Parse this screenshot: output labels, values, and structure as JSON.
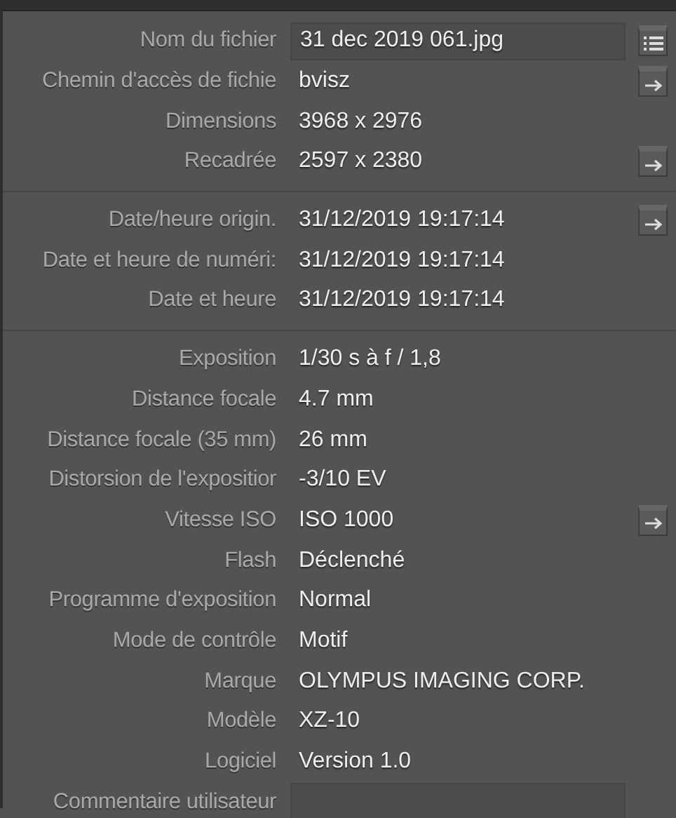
{
  "sections": [
    {
      "rows": [
        {
          "label": "Nom du fichier",
          "value": "31 dec 2019 061.jpg",
          "kind": "field",
          "button": {
            "kind": "list"
          }
        },
        {
          "label": "Chemin d'accès de fichie",
          "value": "bvisz",
          "kind": "plain",
          "button": {
            "kind": "arrow"
          }
        },
        {
          "label": "Dimensions",
          "value": "3968 x 2976",
          "kind": "plain"
        },
        {
          "label": "Recadrée",
          "value": "2597 x 2380",
          "kind": "plain",
          "button": {
            "kind": "arrow"
          }
        }
      ]
    },
    {
      "rows": [
        {
          "label": "Date/heure origin.",
          "value": "31/12/2019 19:17:14",
          "kind": "plain",
          "button": {
            "kind": "arrow"
          }
        },
        {
          "label": "Date et heure de numéri:",
          "value": "31/12/2019 19:17:14",
          "kind": "plain"
        },
        {
          "label": "Date et heure",
          "value": "31/12/2019 19:17:14",
          "kind": "plain"
        }
      ]
    },
    {
      "rows": [
        {
          "label": "Exposition",
          "value": "1/30 s à f / 1,8",
          "kind": "plain"
        },
        {
          "label": "Distance focale",
          "value": "4.7 mm",
          "kind": "plain"
        },
        {
          "label": "Distance focale (35 mm)",
          "value": "26 mm",
          "kind": "plain"
        },
        {
          "label": "Distorsion de l'expositior",
          "value": "-3/10 EV",
          "kind": "plain"
        },
        {
          "label": "Vitesse ISO",
          "value": "ISO 1000",
          "kind": "plain",
          "button": {
            "kind": "arrow"
          }
        },
        {
          "label": "Flash",
          "value": "Déclenché",
          "kind": "plain"
        },
        {
          "label": "Programme d'exposition",
          "value": "Normal",
          "kind": "plain"
        },
        {
          "label": "Mode de contrôle",
          "value": "Motif",
          "kind": "plain"
        },
        {
          "label": "Marque",
          "value": "OLYMPUS IMAGING CORP.",
          "kind": "plain"
        },
        {
          "label": "Modèle",
          "value": "XZ-10",
          "kind": "plain"
        },
        {
          "label": "Logiciel",
          "value": "Version 1.0",
          "kind": "plain"
        },
        {
          "label": "Commentaire utilisateur",
          "kind": "field"
        }
      ]
    }
  ]
}
